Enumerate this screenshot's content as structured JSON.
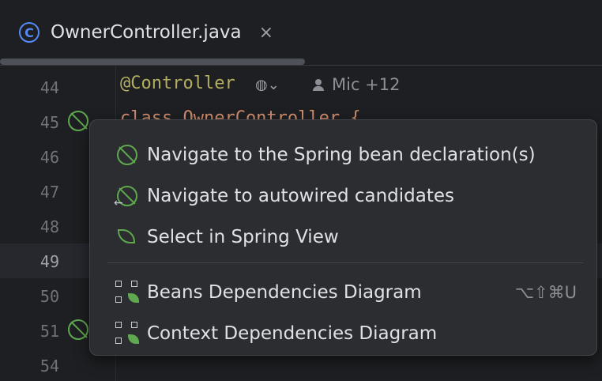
{
  "tab": {
    "icon": "class-c-icon",
    "title": "OwnerController.java",
    "close": "×"
  },
  "editor": {
    "line_numbers": [
      "44",
      "45",
      "46",
      "47",
      "48",
      "49",
      "50",
      "51",
      "54"
    ],
    "annotation": "@Controller",
    "author": "Mic +12",
    "behind_code": "class OwnerController {"
  },
  "popup": {
    "items": [
      {
        "label": "Navigate to the Spring bean declaration(s)",
        "icon": "spring-bean-icon"
      },
      {
        "label": "Navigate to autowired candidates",
        "icon": "autowired-icon"
      },
      {
        "label": "Select in Spring View",
        "icon": "spring-leaf-icon"
      },
      {
        "label": "Beans Dependencies Diagram",
        "icon": "diagram-icon",
        "shortcut": "⌥⇧⌘U"
      },
      {
        "label": "Context Dependencies Diagram",
        "icon": "diagram-icon"
      }
    ]
  },
  "colors": {
    "accent_green": "#5fa84f",
    "accent_blue": "#548af7",
    "annotation": "#b3ae60"
  }
}
